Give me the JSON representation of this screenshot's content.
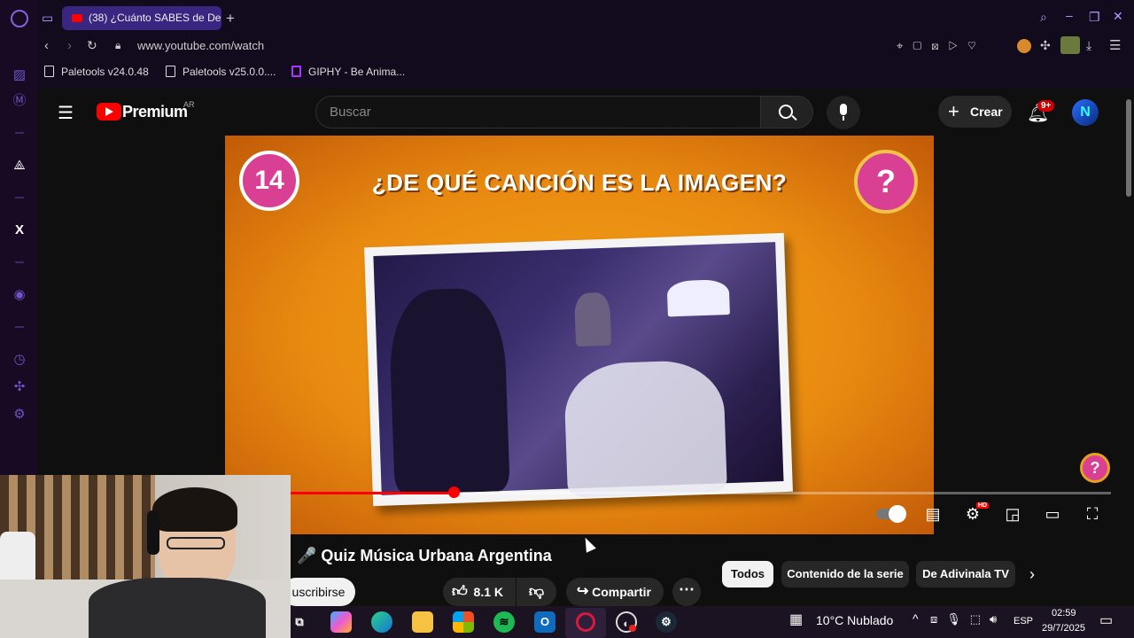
{
  "browser": {
    "tab_title": "(38) ¿Cuánto SABES de De",
    "url": "www.youtube.com/watch",
    "bookmarks": [
      "Paletools v24.0.48",
      "Paletools v25.0.0....",
      "GIPHY - Be Anima..."
    ]
  },
  "youtube": {
    "logo": "Premium",
    "region": "AR",
    "search_placeholder": "Buscar",
    "create_label": "Crear",
    "notifications": "9+"
  },
  "video": {
    "badge_number": "14",
    "question": "¿DE QUÉ CANCIÓN ES LA IMAGEN?",
    "question_mark": "?",
    "progress": 0.258,
    "title": "🎤 Quiz Música Urbana Argentina",
    "likes": "8.1 K",
    "share_label": "Compartir",
    "subscribe_label": "uscribirse"
  },
  "chips": [
    "Todos",
    "Contenido de la serie",
    "De Adivinala TV"
  ],
  "taskbar": {
    "weather": "10°C  Nublado",
    "lang": "ESP",
    "time": "02:59",
    "date": "29/7/2025"
  }
}
